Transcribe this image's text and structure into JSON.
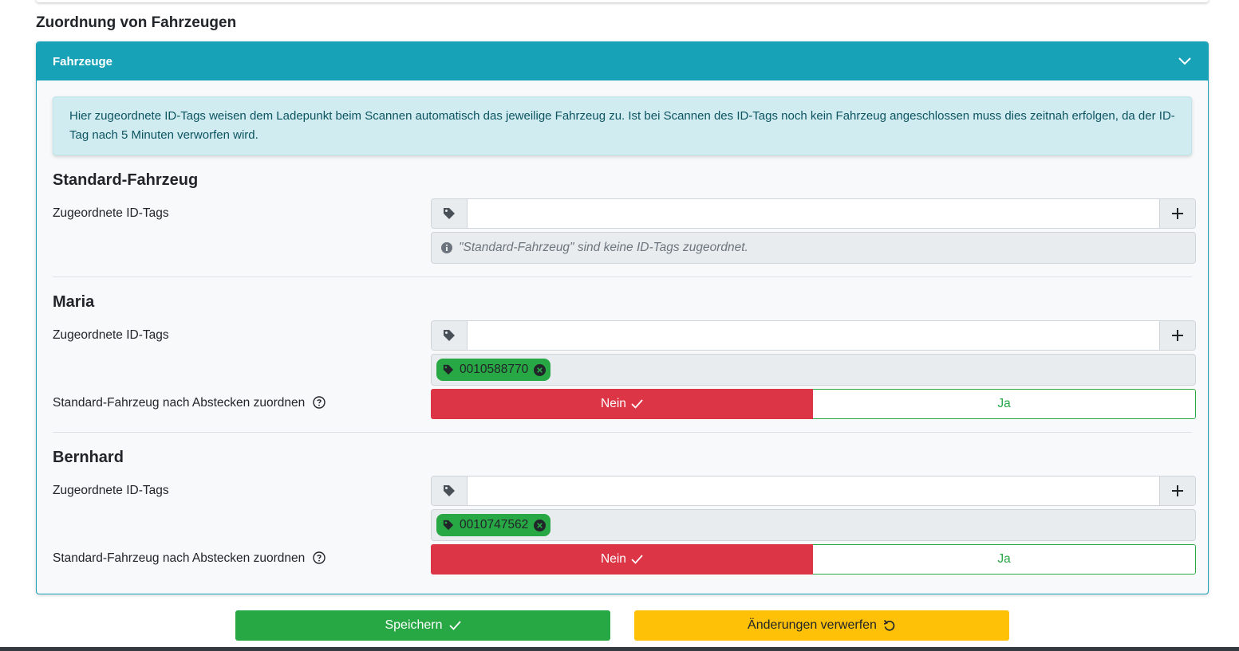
{
  "page": {
    "heading": "Zuordnung von Fahrzeugen"
  },
  "card": {
    "title": "Fahrzeuge",
    "info_text": "Hier zugeordnete ID-Tags weisen dem Ladepunkt beim Scannen automatisch das jeweilige Fahrzeug zu. Ist bei Scannen des ID-Tags noch kein Fahrzeug angeschlossen muss dies zeitnah erfolgen, da der ID-Tag nach 5 Minuten verworfen wird."
  },
  "vehicles": [
    {
      "name": "Standard-Fahrzeug",
      "id_tags_label": "Zugeordnete ID-Tags",
      "id_tag_input_value": "",
      "empty_note": "\"Standard-Fahrzeug\" sind keine ID-Tags zugeordnet.",
      "tags": []
    },
    {
      "name": "Maria",
      "id_tags_label": "Zugeordnete ID-Tags",
      "id_tag_input_value": "",
      "tags": [
        "0010588770"
      ],
      "assign_label": "Standard-Fahrzeug nach Abstecken zuordnen",
      "toggle": {
        "no": "Nein",
        "yes": "Ja",
        "selected": "Nein"
      }
    },
    {
      "name": "Bernhard",
      "id_tags_label": "Zugeordnete ID-Tags",
      "id_tag_input_value": "",
      "tags": [
        "0010747562"
      ],
      "assign_label": "Standard-Fahrzeug nach Abstecken zuordnen",
      "toggle": {
        "no": "Nein",
        "yes": "Ja",
        "selected": "Nein"
      }
    }
  ],
  "actions": {
    "save": "Speichern",
    "discard": "Änderungen verwerfen"
  },
  "colors": {
    "info": "#17a2b8",
    "danger": "#dc3545",
    "success": "#28a745",
    "warning": "#ffc107"
  },
  "icons": [
    "chevron-down-icon",
    "tag-icon",
    "plus-icon",
    "info-circle-icon",
    "remove-tag-icon",
    "question-circle-icon",
    "check-icon",
    "undo-icon"
  ]
}
